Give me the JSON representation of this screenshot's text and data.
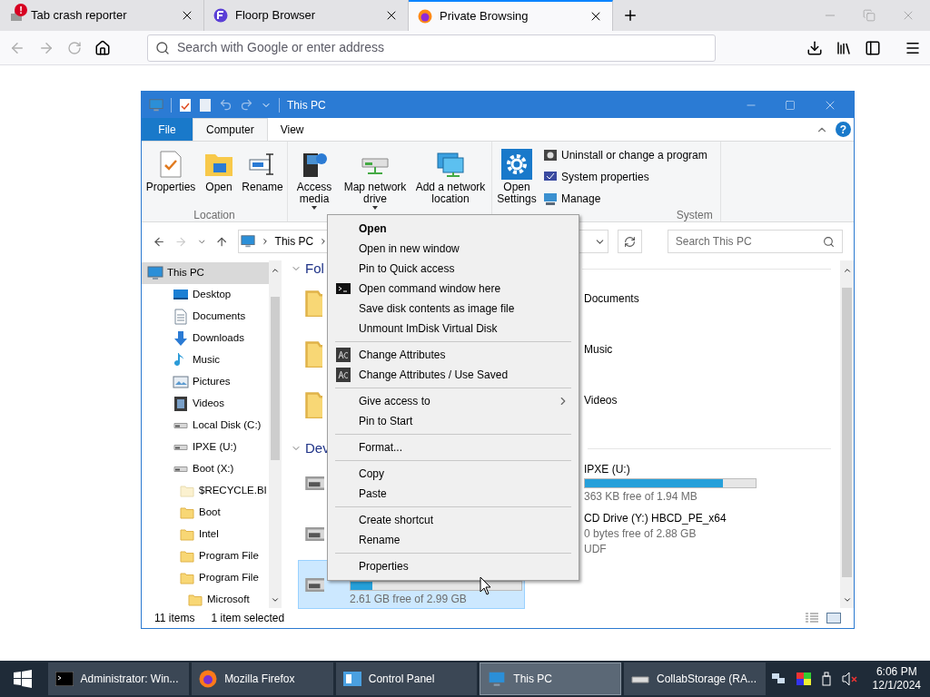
{
  "browser": {
    "tabs": [
      {
        "title": "Tab crash reporter",
        "badge": "!",
        "selected": false
      },
      {
        "title": "Floorp Browser",
        "selected": false
      },
      {
        "title": "Private Browsing",
        "selected": true
      }
    ],
    "address": {
      "placeholder": "Search with Google or enter address"
    }
  },
  "explorer": {
    "title": "This PC",
    "ribbon_tabs": [
      {
        "label": "File",
        "kind": "file",
        "selected": false
      },
      {
        "label": "Computer",
        "kind": "tab",
        "selected": true
      },
      {
        "label": "View",
        "kind": "tab",
        "selected": false
      }
    ],
    "help": "?",
    "groups": [
      {
        "label": "Location",
        "buttons": [
          {
            "label": "Properties",
            "dropdown": false
          },
          {
            "label": "Open",
            "dropdown": false
          },
          {
            "label": "Rename",
            "dropdown": false
          }
        ]
      },
      {
        "buttons": [
          {
            "label": "Access media",
            "dropdown": true
          },
          {
            "label": "Map network drive",
            "dropdown": true
          },
          {
            "label": "Add a network location",
            "dropdown": false
          }
        ]
      },
      {
        "label": "System",
        "buttons": [
          {
            "label": "Open Settings",
            "dropdown": false
          }
        ],
        "small_buttons": [
          "Uninstall or change a program",
          "System properties",
          "Manage"
        ]
      }
    ],
    "breadcrumb": [
      "This PC"
    ],
    "search": {
      "placeholder": "Search This PC"
    },
    "nav": [
      {
        "label": "This PC",
        "selected": true,
        "children": [
          {
            "label": "Desktop",
            "selected": false
          },
          {
            "label": "Documents",
            "selected": false
          },
          {
            "label": "Downloads",
            "selected": false
          },
          {
            "label": "Music",
            "selected": false
          },
          {
            "label": "Pictures",
            "selected": false
          },
          {
            "label": "Videos",
            "selected": false
          },
          {
            "label": "Local Disk (C:)",
            "selected": false
          },
          {
            "label": "IPXE (U:)",
            "selected": false
          },
          {
            "label": "Boot (X:)",
            "selected": false,
            "children": [
              {
                "label": "$RECYCLE.BI",
                "selected": false,
                "hidden": true
              },
              {
                "label": "Boot",
                "selected": false,
                "hidden": false
              },
              {
                "label": "Intel",
                "selected": false,
                "hidden": false
              },
              {
                "label": "Program File",
                "selected": false,
                "hidden": false
              },
              {
                "label": "Program File",
                "selected": false,
                "hidden": false,
                "children": [
                  {
                    "label": "Microsoft",
                    "selected": false,
                    "hidden": false
                  }
                ]
              }
            ]
          }
        ]
      }
    ],
    "sections": [
      {
        "header": "Fol",
        "kind": "folders",
        "rows": [
          [
            {
              "kind": "folder",
              "selected": false
            },
            {
              "kind": "folder",
              "name": "Documents",
              "selected": false
            }
          ],
          [
            {
              "kind": "folder",
              "selected": false
            },
            {
              "kind": "folder",
              "name": "Music",
              "selected": false
            }
          ],
          [
            {
              "kind": "folder",
              "selected": false
            },
            {
              "kind": "folder",
              "name": "Videos",
              "selected": false
            }
          ]
        ]
      },
      {
        "header": "Dev",
        "kind": "devices",
        "rows": [
          [
            {
              "kind": "drive",
              "selected": false
            },
            {
              "kind": "drive",
              "name": "IPXE (U:)",
              "level": 0.81,
              "free": "363 KB free of 1.94 MB",
              "selected": false
            }
          ],
          [
            {
              "kind": "drive",
              "selected": false
            },
            {
              "kind": "drive",
              "name": "CD Drive (Y:) HBCD_PE_x64",
              "free": "0 bytes free of 2.88 GB",
              "filesystem": "UDF",
              "selected": false
            }
          ],
          [
            {
              "kind": "drive",
              "level": 0.13,
              "free": "2.61 GB free of 2.99 GB",
              "selected": true
            }
          ]
        ]
      }
    ],
    "status": {
      "count": "11 items",
      "selection": "1 item selected"
    }
  },
  "context_menu": [
    {
      "kind": "plain",
      "label": "Open",
      "default": true
    },
    {
      "kind": "plain",
      "label": "Open in new window",
      "default": false
    },
    {
      "kind": "plain",
      "label": "Pin to Quick access",
      "default": false
    },
    {
      "kind": "console",
      "label": "Open command window here",
      "default": false
    },
    {
      "kind": "plain",
      "label": "Save disk contents as image file",
      "default": false
    },
    {
      "kind": "plain",
      "label": "Unmount ImDisk Virtual Disk",
      "default": false
    },
    {
      "kind": "separator"
    },
    {
      "kind": "attributes",
      "label": "Change Attributes",
      "default": false
    },
    {
      "kind": "attributes",
      "label": "Change Attributes / Use Saved",
      "default": false
    },
    {
      "kind": "separator"
    },
    {
      "kind": "submenu",
      "label": "Give access to",
      "default": false
    },
    {
      "kind": "plain",
      "label": "Pin to Start",
      "default": false
    },
    {
      "kind": "separator"
    },
    {
      "kind": "plain",
      "label": "Format...",
      "default": false
    },
    {
      "kind": "separator"
    },
    {
      "kind": "plain",
      "label": "Copy",
      "default": false
    },
    {
      "kind": "plain",
      "label": "Paste",
      "default": false
    },
    {
      "kind": "separator"
    },
    {
      "kind": "plain",
      "label": "Create shortcut",
      "default": false
    },
    {
      "kind": "plain",
      "label": "Rename",
      "default": false
    },
    {
      "kind": "separator"
    },
    {
      "kind": "plain",
      "label": "Properties",
      "default": false
    }
  ],
  "taskbar": {
    "items": [
      {
        "label": "Administrator: Win...",
        "selected": false
      },
      {
        "label": "Mozilla Firefox",
        "selected": false
      },
      {
        "label": "Control Panel",
        "selected": false
      },
      {
        "label": "This PC",
        "selected": true
      },
      {
        "label": "CollabStorage (RA...",
        "selected": false
      }
    ],
    "time": "6:06 PM",
    "date": "12/1/2024"
  }
}
